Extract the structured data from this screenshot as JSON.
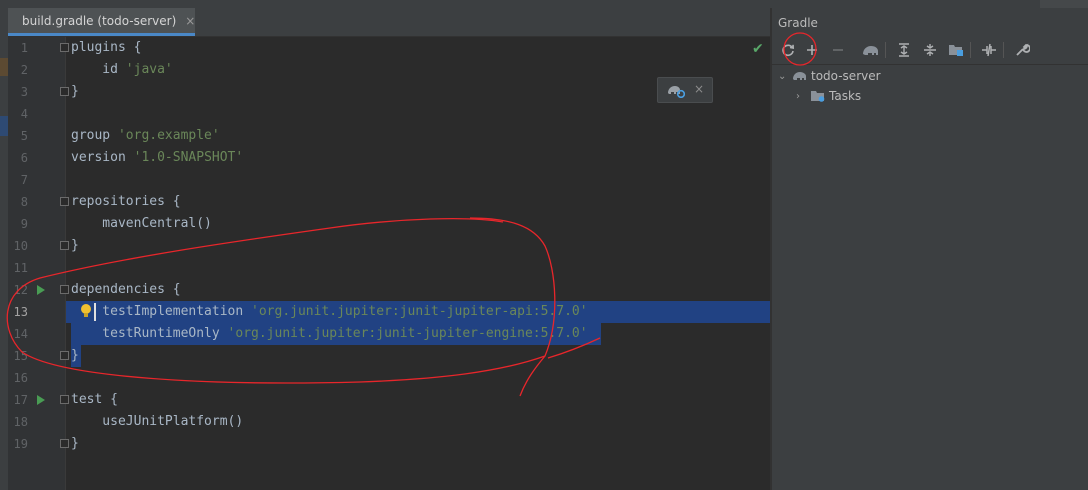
{
  "tab": {
    "title": "build.gradle (todo-server)",
    "close": "×"
  },
  "editor": {
    "lines": [
      {
        "n": "1",
        "parts": [
          [
            "k",
            "plugins {"
          ]
        ]
      },
      {
        "n": "2",
        "parts": [
          [
            "k",
            "    id "
          ],
          [
            "s",
            "'java'"
          ]
        ]
      },
      {
        "n": "3",
        "parts": [
          [
            "k",
            "}"
          ]
        ]
      },
      {
        "n": "4",
        "parts": []
      },
      {
        "n": "5",
        "parts": [
          [
            "k",
            "group "
          ],
          [
            "s",
            "'org.example'"
          ]
        ]
      },
      {
        "n": "6",
        "parts": [
          [
            "k",
            "version "
          ],
          [
            "s",
            "'1.0-SNAPSHOT'"
          ]
        ]
      },
      {
        "n": "7",
        "parts": []
      },
      {
        "n": "8",
        "parts": [
          [
            "k",
            "repositories {"
          ]
        ]
      },
      {
        "n": "9",
        "parts": [
          [
            "k",
            "    mavenCentral()"
          ]
        ]
      },
      {
        "n": "10",
        "parts": [
          [
            "k",
            "}"
          ]
        ]
      },
      {
        "n": "11",
        "parts": []
      },
      {
        "n": "12",
        "parts": [
          [
            "k",
            "dependencies {"
          ]
        ]
      },
      {
        "n": "13",
        "parts": [
          [
            "k",
            "    testImplementation "
          ],
          [
            "s",
            "'org.junit.jupiter:junit-jupiter-api:5.7.0'"
          ]
        ]
      },
      {
        "n": "14",
        "parts": [
          [
            "k",
            "    testRuntimeOnly "
          ],
          [
            "s",
            "'org.junit.jupiter:junit-jupiter-engine:5.7.0'"
          ]
        ]
      },
      {
        "n": "15",
        "parts": [
          [
            "k",
            "}"
          ]
        ]
      },
      {
        "n": "16",
        "parts": []
      },
      {
        "n": "17",
        "parts": [
          [
            "k",
            "test {"
          ]
        ]
      },
      {
        "n": "18",
        "parts": [
          [
            "k",
            "    useJUnitPlatform()"
          ]
        ]
      },
      {
        "n": "19",
        "parts": [
          [
            "k",
            "}"
          ]
        ]
      }
    ],
    "current_line": "13",
    "run_icon_lines": [
      "12",
      "17"
    ],
    "fold_lines": [
      "1",
      "3",
      "8",
      "10",
      "12",
      "15",
      "17",
      "19"
    ]
  },
  "gradle_panel": {
    "title": "Gradle",
    "toolbar": [
      "refresh-icon",
      "add-icon",
      "remove-icon",
      "elephant-icon",
      "expand-all-icon",
      "collapse-all-icon",
      "dependencies-icon",
      "toggle-offline-icon",
      "settings-wrench-icon"
    ],
    "tree": [
      {
        "label": "todo-server",
        "expanded": true,
        "level": 0
      },
      {
        "label": "Tasks",
        "expanded": false,
        "level": 1
      }
    ]
  },
  "colors": {
    "keyword": "#a9b7c6",
    "string": "#6a8759",
    "selection": "#214283",
    "annotation": "#e8262b"
  }
}
